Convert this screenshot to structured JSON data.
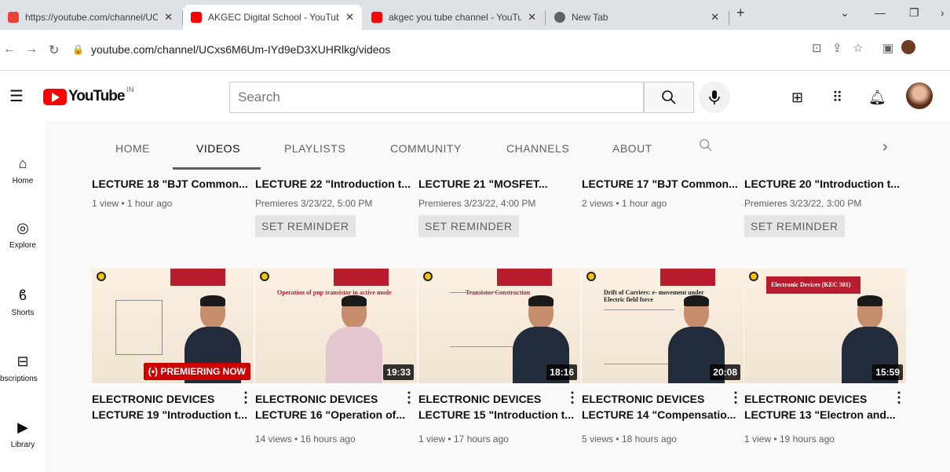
{
  "browser": {
    "tabs": [
      {
        "title": "https://youtube.com/channel/UC",
        "favicon_color": "#ea4335",
        "favicon": "gmail-icon"
      },
      {
        "title": "AKGEC Digital School - YouTube",
        "favicon_color": "#ff0000",
        "favicon": "youtube-icon"
      },
      {
        "title": "akgec you tube channel - YouTul",
        "favicon_color": "#ff0000",
        "favicon": "youtube-icon"
      },
      {
        "title": "New Tab",
        "favicon_color": "#5f6368",
        "favicon": "chrome-icon"
      }
    ],
    "close_glyph": "✕",
    "new_tab_glyph": "+",
    "url": "youtube.com/channel/UCxs6M6Um-IYd9eD3XUHRlkg/videos"
  },
  "youtube": {
    "logo_text": "YouTube",
    "region": "IN",
    "search_placeholder": "Search",
    "sidebar": [
      {
        "label": "Home",
        "icon": "home-icon",
        "glyph": "⌂"
      },
      {
        "label": "Explore",
        "icon": "compass-icon",
        "glyph": "◎"
      },
      {
        "label": "Shorts",
        "icon": "shorts-icon",
        "glyph": "ϐ"
      },
      {
        "label": "bscriptions",
        "icon": "subscriptions-icon",
        "glyph": "⊟"
      },
      {
        "label": "Library",
        "icon": "library-icon",
        "glyph": "▶"
      }
    ],
    "channel_tabs": [
      "HOME",
      "VIDEOS",
      "PLAYLISTS",
      "COMMUNITY",
      "CHANNELS",
      "ABOUT"
    ],
    "active_tab": "VIDEOS",
    "row1": [
      {
        "title": "LECTURE 18 \"BJT Common...",
        "meta": "1 view • 1 hour ago",
        "reminder": ""
      },
      {
        "title": "LECTURE 22 \"Introduction t...",
        "meta": "Premieres 3/23/22, 5:00 PM",
        "reminder": "SET REMINDER"
      },
      {
        "title": "LECTURE 21 \"MOSFET...",
        "meta": "Premieres 3/23/22, 4:00 PM",
        "reminder": "SET REMINDER"
      },
      {
        "title": "LECTURE 17 \"BJT Common...",
        "meta": "2 views • 1 hour ago",
        "reminder": ""
      },
      {
        "title": "LECTURE 20 \"Introduction t...",
        "meta": "Premieres 3/23/22, 3:00 PM",
        "reminder": "SET REMINDER"
      }
    ],
    "row2": [
      {
        "line1": "ELECTRONIC DEVICES",
        "line2": "LECTURE 19 \"Introduction t...",
        "meta": "",
        "badge": "(•) PREMIERING NOW",
        "slide": "",
        "duration": ""
      },
      {
        "line1": "ELECTRONIC DEVICES",
        "line2": "LECTURE 16 \"Operation of...",
        "meta": "14 views • 16 hours ago",
        "badge": "",
        "slide": "Operation of pnp transistor in active mode",
        "duration": "19:33"
      },
      {
        "line1": "ELECTRONIC DEVICES",
        "line2": "LECTURE 15 \"Introduction t...",
        "meta": "1 view • 17 hours ago",
        "badge": "",
        "slide": "Transistor Construction",
        "duration": "18:16"
      },
      {
        "line1": "ELECTRONIC DEVICES",
        "line2": "LECTURE 14 \"Compensatio...",
        "meta": "5 views • 18 hours ago",
        "badge": "",
        "slide": "Drift of Carriers: e- movement under Electric field force",
        "duration": "20:08"
      },
      {
        "line1": "ELECTRONIC DEVICES",
        "line2": "LECTURE 13 \"Electron and...",
        "meta": "1 view • 19 hours ago",
        "badge": "",
        "slide": "Electronic Devices (KEC 301)",
        "duration": "15:59"
      }
    ]
  }
}
